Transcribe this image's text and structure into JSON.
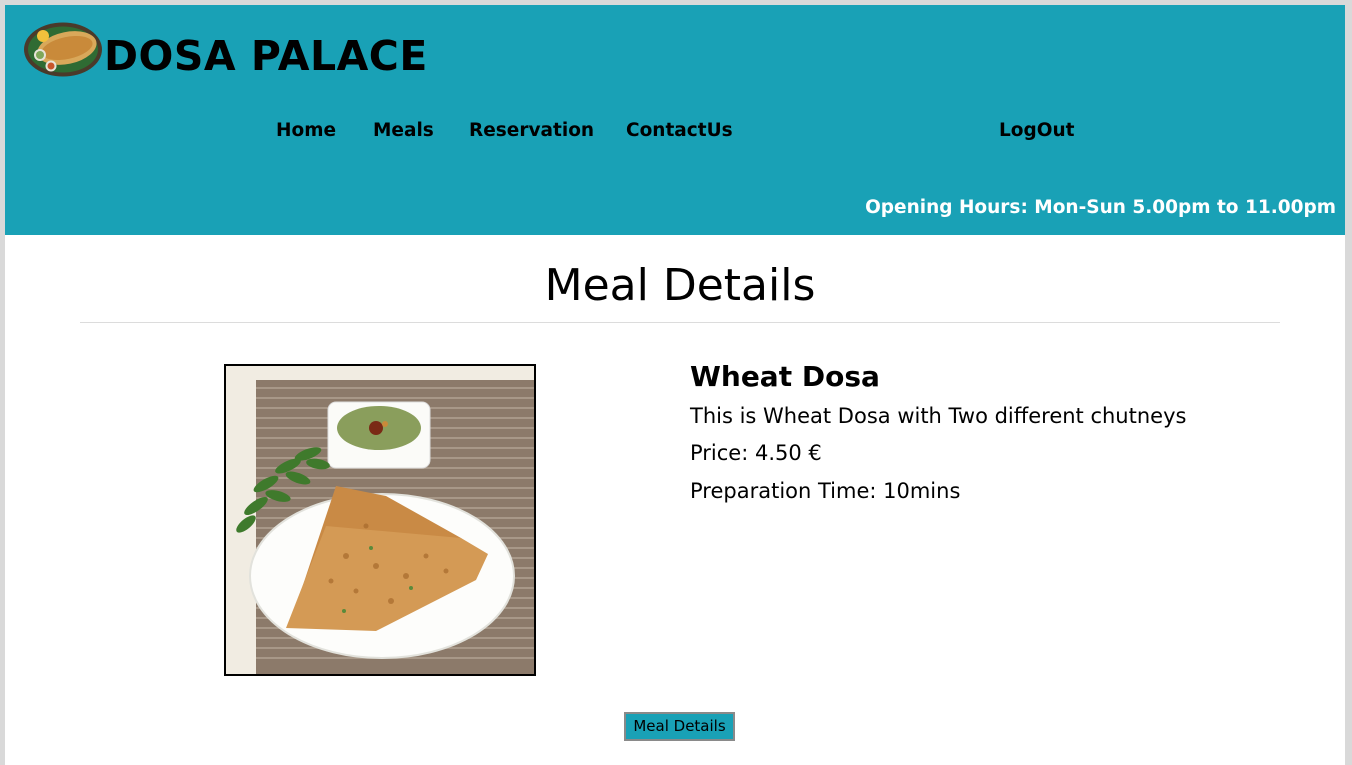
{
  "header": {
    "brand": "DOSA PALACE",
    "logo_icon": "dosa-plate-logo",
    "nav": [
      {
        "label": "Home"
      },
      {
        "label": "Meals"
      },
      {
        "label": "Reservation"
      },
      {
        "label": "ContactUs"
      }
    ],
    "logout_label": "LogOut",
    "opening_hours": "Opening Hours: Mon-Sun 5.00pm to 11.00pm",
    "colors": {
      "background": "#19a1b6",
      "hours_text": "#ffffff"
    }
  },
  "main": {
    "title": "Meal Details",
    "meal": {
      "name": "Wheat Dosa",
      "description": "This is Wheat Dosa with Two different chutneys",
      "price": "Price: 4.50 €",
      "prep_time": "Preparation Time: 10mins",
      "image_icon": "wheat-dosa-photo"
    },
    "button_label": "Meal Details"
  }
}
